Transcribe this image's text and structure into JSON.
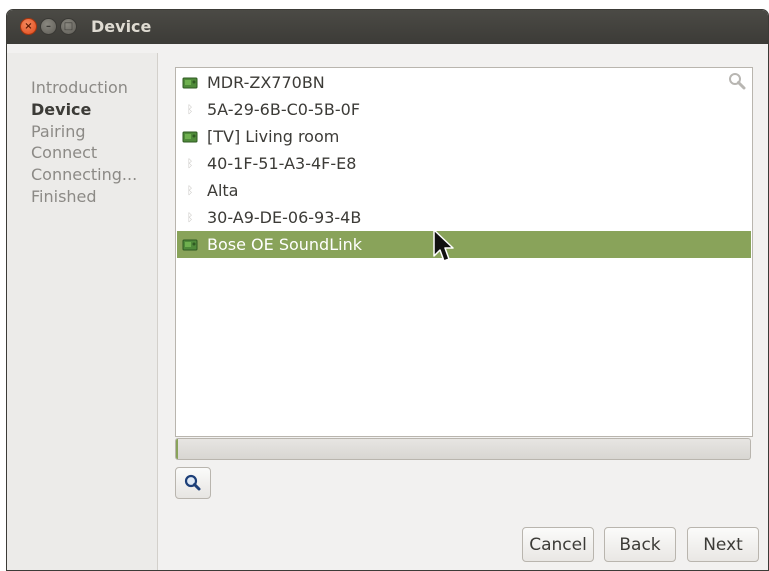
{
  "window": {
    "title": "Device"
  },
  "title_buttons": {
    "close": "×",
    "minimize": "–",
    "maximize": "□"
  },
  "steps": [
    "Introduction",
    "Device",
    "Pairing",
    "Connect",
    "Connecting...",
    "Finished"
  ],
  "active_step": "Device",
  "devices": [
    {
      "label": "MDR-ZX770BN",
      "icon": "audio-device-icon",
      "selected": false
    },
    {
      "label": "5A-29-6B-C0-5B-0F",
      "icon": "bluetooth-icon",
      "selected": false
    },
    {
      "label": "[TV] Living room",
      "icon": "audio-device-icon",
      "selected": false
    },
    {
      "label": "40-1F-51-A3-4F-E8",
      "icon": "bluetooth-icon",
      "selected": false
    },
    {
      "label": "Alta",
      "icon": "bluetooth-icon",
      "selected": false
    },
    {
      "label": "30-A9-DE-06-93-4B",
      "icon": "bluetooth-icon",
      "selected": false
    },
    {
      "label": "Bose OE SoundLink",
      "icon": "audio-device-icon",
      "selected": true
    }
  ],
  "search_progress": 0.003,
  "buttons": {
    "cancel": "Cancel",
    "back": "Back",
    "next": "Next"
  },
  "colors": {
    "selection": "#89a35a",
    "titlebar": "#3c3b37",
    "close_button": "#e0491b"
  }
}
